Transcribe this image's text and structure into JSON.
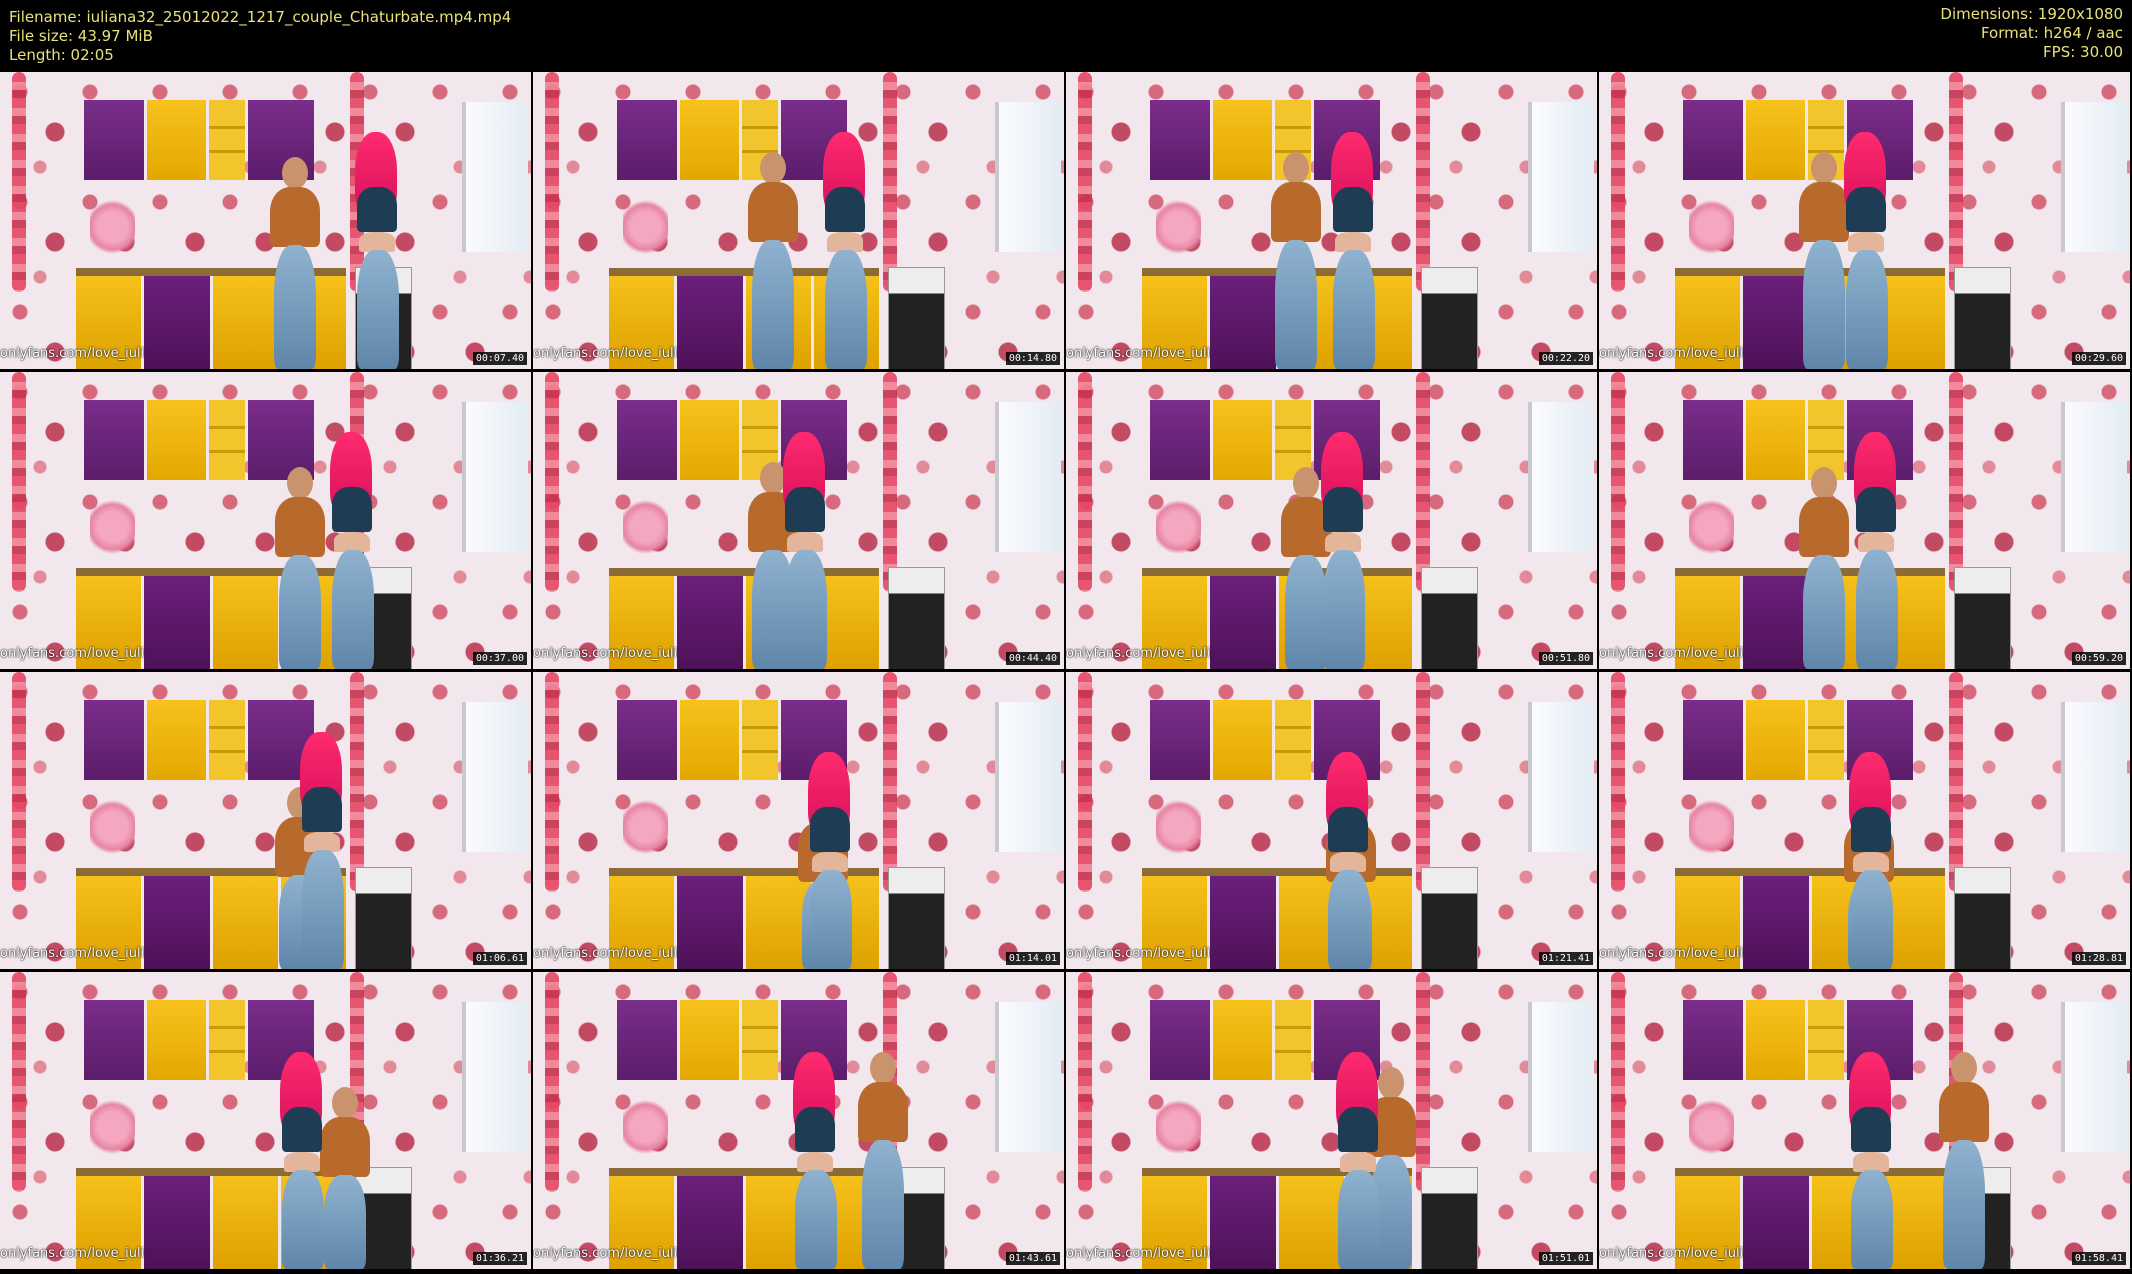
{
  "info": {
    "filename": "Filename: iuliana32_25012022_1217_couple_Chaturbate.mp4.mp4",
    "filesize": "File size: 43.97 MiB",
    "length": "Length: 02:05",
    "dimensions": "Dimensions: 1920x1080",
    "format": "Format: h264 / aac",
    "fps": "FPS: 30.00"
  },
  "thumbnails": [
    {
      "watermark": "onlyfans.com/love_iuli",
      "timestamp": "00:07.40"
    },
    {
      "watermark": "onlyfans.com/love_iuli",
      "timestamp": "00:14.80"
    },
    {
      "watermark": "onlyfans.com/love_iuli",
      "timestamp": "00:22.20"
    },
    {
      "watermark": "onlyfans.com/love_iuli",
      "timestamp": "00:29.60"
    },
    {
      "watermark": "onlyfans.com/love_iuli",
      "timestamp": "00:37.00"
    },
    {
      "watermark": "onlyfans.com/love_iuli",
      "timestamp": "00:44.40"
    },
    {
      "watermark": "onlyfans.com/love_iuli",
      "timestamp": "00:51.80"
    },
    {
      "watermark": "onlyfans.com/love_iuli",
      "timestamp": "00:59.20"
    },
    {
      "watermark": "onlyfans.com/love_iuli",
      "timestamp": "01:06.61"
    },
    {
      "watermark": "onlyfans.com/love_iuli",
      "timestamp": "01:14.01"
    },
    {
      "watermark": "onlyfans.com/love_iuli",
      "timestamp": "01:21.41"
    },
    {
      "watermark": "onlyfans.com/love_iuli",
      "timestamp": "01:28.81"
    },
    {
      "watermark": "onlyfans.com/love_iuli",
      "timestamp": "01:36.21"
    },
    {
      "watermark": "onlyfans.com/love_iuli",
      "timestamp": "01:43.61"
    },
    {
      "watermark": "onlyfans.com/love_iuli",
      "timestamp": "01:51.01"
    },
    {
      "watermark": "onlyfans.com/love_iuli",
      "timestamp": "01:58.41"
    }
  ]
}
